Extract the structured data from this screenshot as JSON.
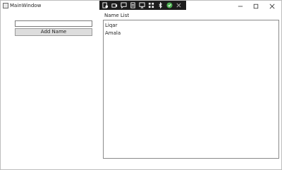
{
  "window": {
    "title": "MainWindow"
  },
  "toolbar": {
    "icons": [
      "record-icon",
      "video-icon",
      "chat-icon",
      "document-icon",
      "screen-icon",
      "grid-icon",
      "bluetooth-icon",
      "check-icon",
      "close-icon"
    ]
  },
  "form": {
    "name_input_value": "",
    "add_button_label": "Add Name"
  },
  "list": {
    "label": "Name List",
    "items": [
      "Liqar",
      "Amala"
    ]
  }
}
